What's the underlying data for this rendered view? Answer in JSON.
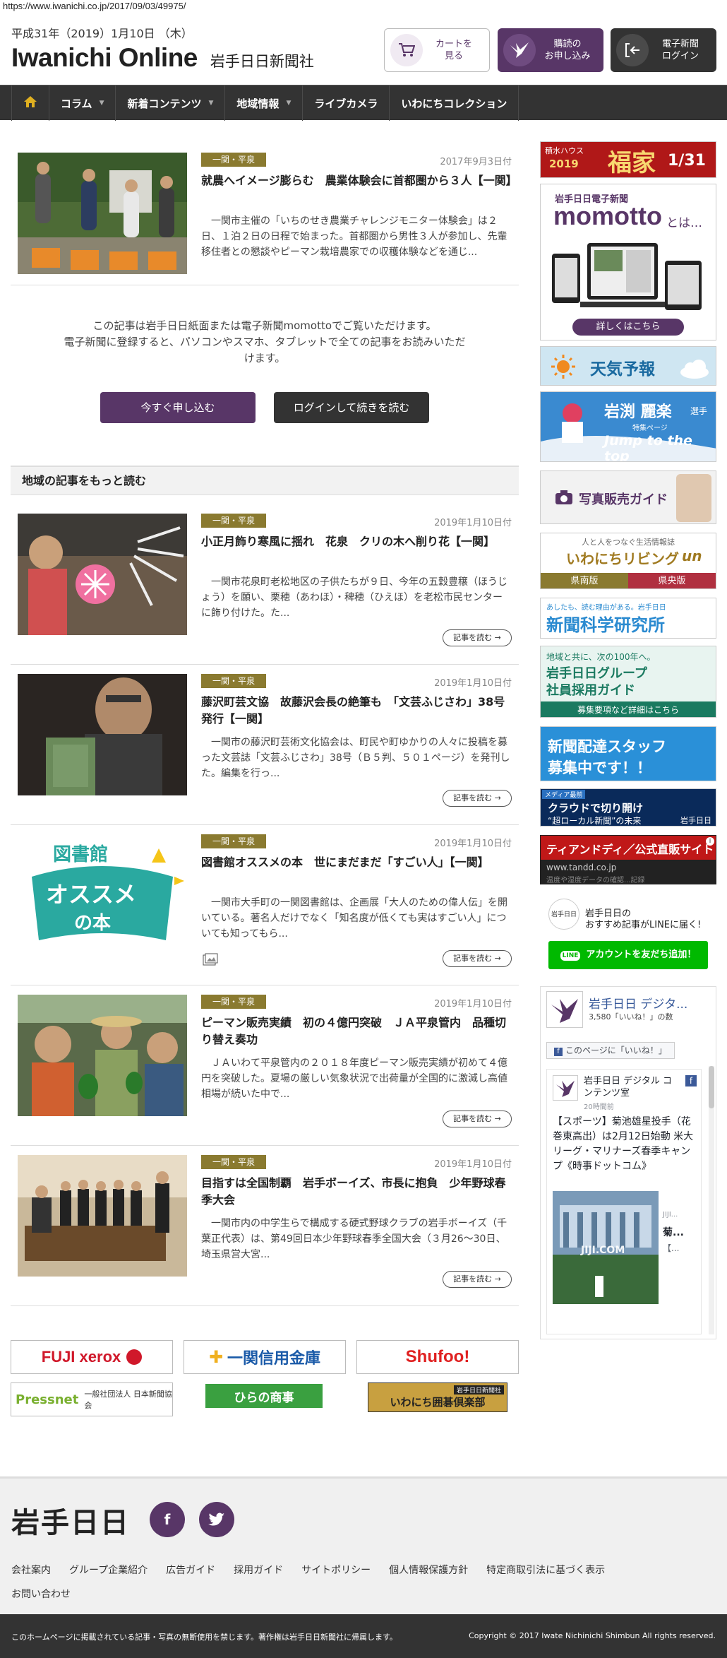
{
  "url": "https://www.iwanichi.co.jp/2017/09/03/49975/",
  "header": {
    "date": "平成31年（2019）1月10日 （木）",
    "brand_en": "Iwanichi Online",
    "brand_jp": "岩手日日新聞社",
    "cart": [
      "カートを",
      "見る"
    ],
    "subscribe": [
      "購読の",
      "お申し込み"
    ],
    "login": [
      "電子新聞",
      "ログイン"
    ]
  },
  "nav": {
    "items": [
      {
        "label": "コラム",
        "dropdown": true
      },
      {
        "label": "新着コンテンツ",
        "dropdown": true
      },
      {
        "label": "地域情報",
        "dropdown": true
      },
      {
        "label": "ライブカメラ",
        "dropdown": false
      },
      {
        "label": "いわにちコレクション",
        "dropdown": false
      }
    ]
  },
  "lead": {
    "category": "一関・平泉",
    "date": "2017年9月3日付",
    "title": "就農へイメージ膨らむ　農業体験会に首都圏から３人【一関】",
    "summary": "一関市主催の「いちのせき農業チャレンジモニター体験会」は２日、１泊２日の日程で始まった。首都圏から男性３人が参加し、先輩移住者との懇談やピーマン栽培農家での収穫体験などを通じ..."
  },
  "paywall": {
    "lines": [
      "この記事は岩手日日紙面または電子新聞momottoでご覧いただけます。",
      "電子新聞に登録すると、パソコンやスマホ、タブレットで全ての記事をお読みいただ",
      "けます。"
    ],
    "apply": "今すぐ申し込む",
    "login": "ログインして続きを読む"
  },
  "region_heading": "地域の記事をもっと読む",
  "read_more": "記事を読む",
  "articles": [
    {
      "category": "一関・平泉",
      "date": "2019年1月10日付",
      "title": "小正月飾り寒風に揺れ　花泉　クリの木へ削り花【一関】",
      "summary": "一関市花泉町老松地区の子供たちが９日、今年の五穀豊穣（ほうじょう）を願い、栗穂（あわほ）・稗穂（ひえほ）を老松市民センターに飾り付けた。た..."
    },
    {
      "category": "一関・平泉",
      "date": "2019年1月10日付",
      "title": "藤沢町芸文協　故藤沢会長の絶筆も　「文芸ふじさわ」38号発行【一関】",
      "summary": "一関市の藤沢町芸術文化協会は、町民や町ゆかりの人々に投稿を募った文芸誌「文芸ふじさわ」38号（Ｂ５判、５０１ページ）を発刊した。編集を行っ..."
    },
    {
      "category": "一関・平泉",
      "date": "2019年1月10日付",
      "title": "図書館オススメの本　世にまだまだ「すごい人」【一関】",
      "summary": "一関市大手町の一関図書館は、企画展「大人のための偉人伝」を開いている。著名人だけでなく「知名度が低くても実はすごい人」についても知ってもら..."
    },
    {
      "category": "一関・平泉",
      "date": "2019年1月10日付",
      "title": "ピーマン販売実績　初の４億円突破　ＪＡ平泉管内　品種切り替え奏功",
      "summary": "ＪＡいわて平泉管内の２０１８年度ピーマン販売実績が初めて４億円を突破した。夏場の厳しい気象状況で出荷量が全国的に激減し高値相場が続いた中で..."
    },
    {
      "category": "一関・平泉",
      "date": "2019年1月10日付",
      "title": "目指すは全国制覇　岩手ボーイズ、市長に抱負　少年野球春季大会",
      "summary": "一関市内の中学生らで構成する硬式野球クラブの岩手ボーイズ（千葉正代表）は、第49回日本少年野球春季全国大会（３月26～30日、埼玉県営大宮..."
    }
  ],
  "library_logo": [
    "図書館",
    "オススメ",
    "の本"
  ],
  "sidebar": {
    "fukuya": {
      "brand": "積水ハウス",
      "year": "2019",
      "title": "福家",
      "date": "1/31"
    },
    "momotto": {
      "top": "岩手日日電子新聞",
      "name": "momotto",
      "suffix": "とは…",
      "btn": "詳しくはこちら"
    },
    "weather": "天気予報",
    "iwabuchi": {
      "name": "岩渕 麗楽",
      "suffix": "選手",
      "sub": "特集ページ",
      "tag": "Jump to the top"
    },
    "photo": "写真販売ガイド",
    "living": {
      "top": "人と人をつなぐ生活情報誌",
      "name": "いわにちリビング",
      "un": "un",
      "a": "県南版",
      "b": "県央版"
    },
    "kagaku": {
      "top": "あしたも、読む理由がある。岩手日日",
      "name": "新聞科学研究所"
    },
    "recruit": {
      "top": "地域と共に、次の100年へ。",
      "name1": "岩手日日グループ",
      "name2": "社員採用ガイド",
      "sub": "募集要項など詳細はこちら"
    },
    "staff": [
      "新聞配達スタッフ",
      "募集中です！！"
    ],
    "cloud": {
      "tag": "メディア最前",
      "l1": "クラウドで切り開け",
      "l2": "“超ローカル新聞”の未来",
      "brand": "岩手日日"
    },
    "ad": {
      "title": "ティアンドディ／公式直販サイト",
      "url": "www.tandd.co.jp",
      "sub": "温度や湿度データの確認...記録"
    },
    "line": {
      "brand": "岩手日日",
      "l1": "岩手日日の",
      "l2": "おすすめ記事がLINEに届く!",
      "btn": "アカウントを友だち追加！"
    },
    "fb": {
      "page": "岩手日日 デジタ...",
      "likes": "3,580「いいね！」の数",
      "like_btn": "このページに「いいね！」",
      "poster": "岩手日日 デジタル コンテンツ室",
      "ago": "20時間前",
      "post": "【スポーツ】菊池雄星投手（花巻東高出）は2月12日始動 米大リーグ・マリナーズ春季キャンプ《時事ドットコム》",
      "src": "JIJI.COM",
      "cap1": "JIJI...",
      "cap2": "菊...",
      "cap3": "【..."
    }
  },
  "footer_logos": {
    "fuji": "FUJI xerox",
    "shinkin": "一関信用金庫",
    "shufoo": "Shufoo!",
    "pressnet": "Pressnet",
    "pressnet_sub": "一般社団法人 日本新聞協会",
    "hira": "ひらの商事",
    "igo_top": "岩手日日新聞社",
    "igo": "いわにち囲碁倶楽部"
  },
  "footer": {
    "logo": "岩手日日",
    "links": [
      "会社案内",
      "グループ企業紹介",
      "広告ガイド",
      "採用ガイド",
      "サイトポリシー",
      "個人情報保護方針",
      "特定商取引法に基づく表示",
      "お問い合わせ"
    ],
    "notice": "このホームページに掲載されている記事・写真の無断使用を禁じます。著作権は岩手日日新聞社に帰属します。",
    "copyright": "Copyright © 2017 Iwate Nichinichi Shimbun All rights reserved."
  },
  "colors": {
    "purple": "#583667",
    "dark": "#333333",
    "gold": "#8a7a30"
  }
}
